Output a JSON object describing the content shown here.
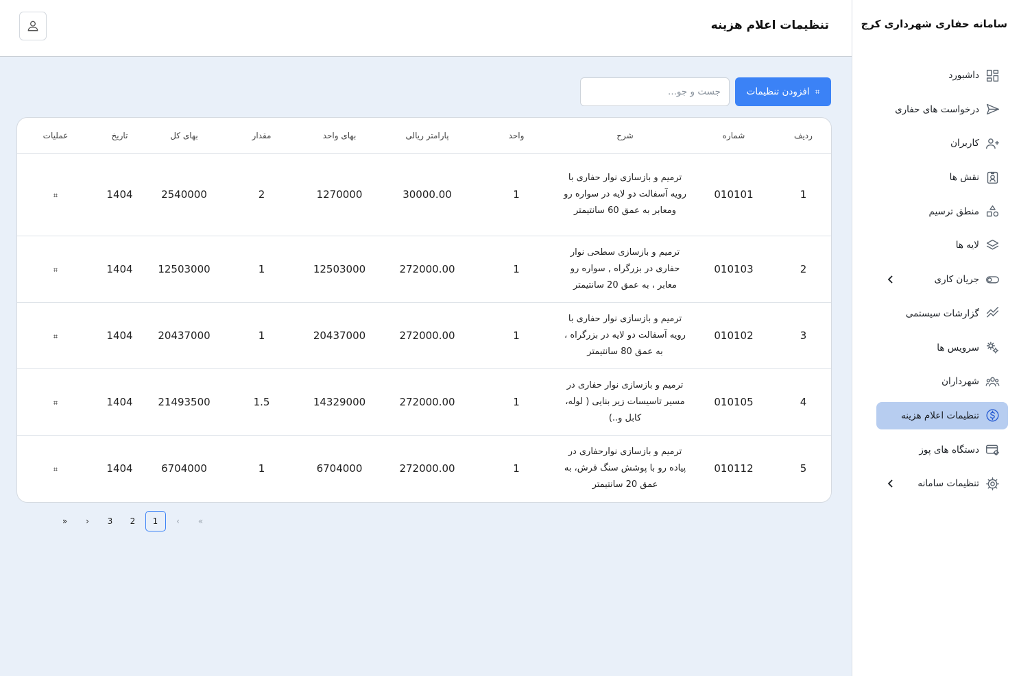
{
  "brand": "سامانه حفاری شهرداری کرج",
  "header": {
    "title": "تنظیمات اعلام هزینه",
    "user_icon": "user-icon"
  },
  "sidebar": {
    "items": [
      {
        "label": "داشبورد",
        "icon": "dashboard-icon",
        "active": false,
        "chevron": false
      },
      {
        "label": "درخواست های حفاری",
        "icon": "send-icon",
        "active": false,
        "chevron": false
      },
      {
        "label": "کاربران",
        "icon": "users-icon",
        "active": false,
        "chevron": false
      },
      {
        "label": "نقش ها",
        "icon": "id-badge-icon",
        "active": false,
        "chevron": false
      },
      {
        "label": "منطق ترسیم",
        "icon": "shapes-icon",
        "active": false,
        "chevron": false
      },
      {
        "label": "لایه ها",
        "icon": "layers-icon",
        "active": false,
        "chevron": false
      },
      {
        "label": "جریان کاری",
        "icon": "toggle-icon",
        "active": false,
        "chevron": true
      },
      {
        "label": "گزارشات سیستمی",
        "icon": "chart-line-icon",
        "active": false,
        "chevron": false
      },
      {
        "label": "سرویس ها",
        "icon": "gears-icon",
        "active": false,
        "chevron": false
      },
      {
        "label": "شهرداران",
        "icon": "group-icon",
        "active": false,
        "chevron": false
      },
      {
        "label": "تنظیمات اعلام هزینه",
        "icon": "dollar-circle-icon",
        "active": true,
        "chevron": false
      },
      {
        "label": "دستگاه های پوز",
        "icon": "card-settings-icon",
        "active": false,
        "chevron": false
      },
      {
        "label": "تنظیمات سامانه",
        "icon": "gear-icon",
        "active": false,
        "chevron": true
      }
    ]
  },
  "toolbar": {
    "add_label": "افزودن تنظیمات",
    "add_glyph": "⌗",
    "search_placeholder": "جست و جو..."
  },
  "table": {
    "headers": [
      "ردیف",
      "شماره",
      "شرح",
      "واحد",
      "پارامتر ریالی",
      "بهای واحد",
      "مقدار",
      "بهای کل",
      "تاریخ",
      "عملیات"
    ],
    "op_glyph": "⌗",
    "rows": [
      [
        "1",
        "010101",
        "ترمیم و بازسازی نوار حفاری با رویه آسفالت دو لایه در سواره رو ومعابر به عمق 60 سانتیمتر",
        "1",
        "30000.00",
        "1270000",
        "2",
        "2540000",
        "1404"
      ],
      [
        "2",
        "010103",
        "ترمیم و بازسازی سطحی نوار حفاری در بزرگراه , سواره رو معابر ، به عمق 20 سانتیمتر",
        "1",
        "272000.00",
        "12503000",
        "1",
        "12503000",
        "1404"
      ],
      [
        "3",
        "010102",
        "ترمیم و بازسازی نوار حفاری با رویه آسفالت دو لایه در بزرگراه ، به عمق 80 سانتیمتر",
        "1",
        "272000.00",
        "20437000",
        "1",
        "20437000",
        "1404"
      ],
      [
        "4",
        "010105",
        "ترمیم و بازسازی نوار حفاری در مسیر تاسیسات زیر بنایی ( لوله، کابل و..)",
        "1",
        "272000.00",
        "14329000",
        "1.5",
        "21493500",
        "1404"
      ],
      [
        "5",
        "010112",
        "ترمیم و بازسازی نوارحفاری در پیاده رو با پوشش سنگ فرش، به عمق 20 سانتیمتر",
        "1",
        "272000.00",
        "6704000",
        "1",
        "6704000",
        "1404"
      ]
    ]
  },
  "pagination": {
    "last": "»",
    "next": "›",
    "pages": [
      "3",
      "2",
      "1"
    ],
    "current": "1",
    "prev": "‹",
    "first": "«"
  }
}
